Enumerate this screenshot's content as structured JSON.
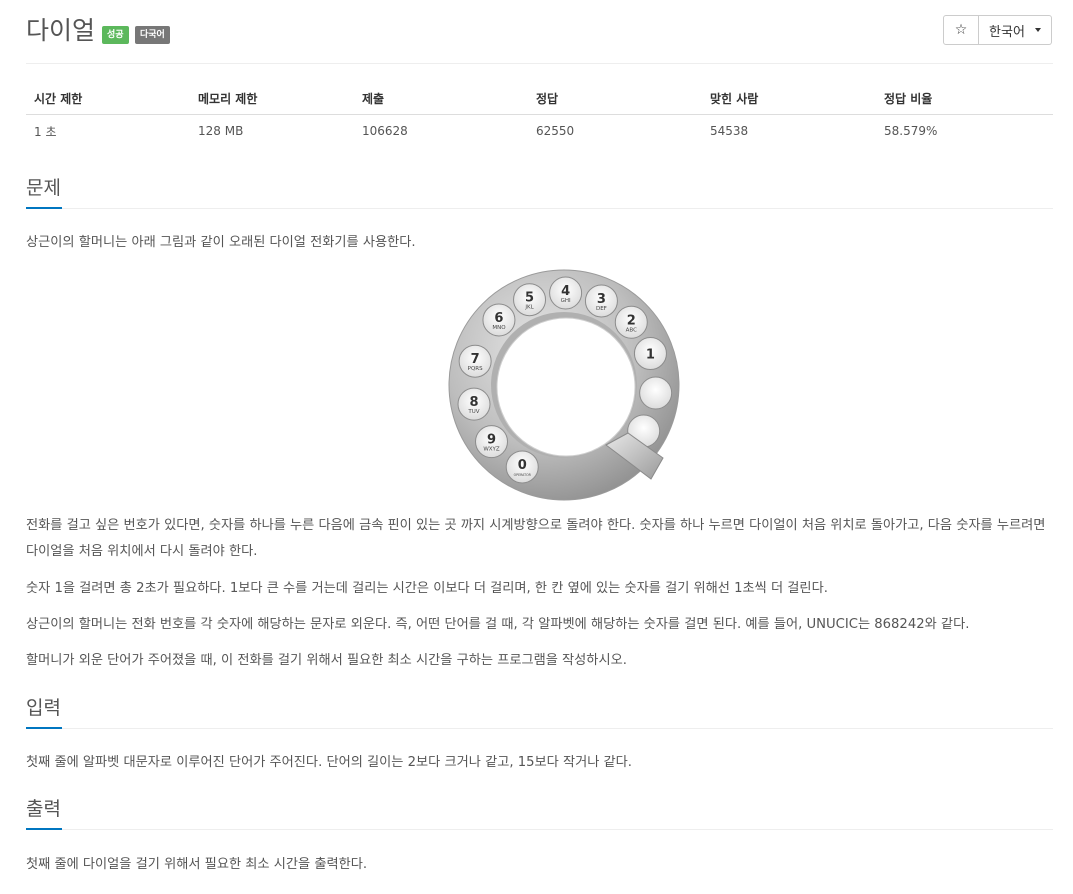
{
  "header": {
    "title": "다이얼",
    "badge_success": "성공",
    "badge_multilang": "다국어",
    "star_icon": "☆",
    "language": "한국어"
  },
  "stats": {
    "headers": [
      "시간 제한",
      "메모리 제한",
      "제출",
      "정답",
      "맞힌 사람",
      "정답 비율"
    ],
    "values": [
      "1 초",
      "128 MB",
      "106628",
      "62550",
      "54538",
      "58.579%"
    ]
  },
  "problem": {
    "heading": "문제",
    "intro": "상근이의 할머니는 아래 그림과 같이 오래된 다이얼 전화기를 사용한다.",
    "dial_labels": [
      {
        "digit": "1",
        "letters": ""
      },
      {
        "digit": "2",
        "letters": "ABC"
      },
      {
        "digit": "3",
        "letters": "DEF"
      },
      {
        "digit": "4",
        "letters": "GHI"
      },
      {
        "digit": "5",
        "letters": "JKL"
      },
      {
        "digit": "6",
        "letters": "MNO"
      },
      {
        "digit": "7",
        "letters": "PQRS"
      },
      {
        "digit": "8",
        "letters": "TUV"
      },
      {
        "digit": "9",
        "letters": "WXYZ"
      },
      {
        "digit": "0",
        "letters": "OPERATOR"
      }
    ],
    "p1": "전화를 걸고 싶은 번호가 있다면, 숫자를 하나를 누른 다음에 금속 핀이 있는 곳 까지 시계방향으로 돌려야 한다. 숫자를 하나 누르면 다이얼이 처음 위치로 돌아가고, 다음 숫자를 누르려면 다이얼을 처음 위치에서 다시 돌려야 한다.",
    "p2": "숫자 1을 걸려면 총 2초가 필요하다. 1보다 큰 수를 거는데 걸리는 시간은 이보다 더 걸리며, 한 칸 옆에 있는 숫자를 걸기 위해선 1초씩 더 걸린다.",
    "p3": "상근이의 할머니는 전화 번호를 각 숫자에 해당하는 문자로 외운다. 즉, 어떤 단어를 걸 때, 각 알파벳에 해당하는 숫자를 걸면 된다. 예를 들어, UNUCIC는 868242와 같다.",
    "p4": "할머니가 외운 단어가 주어졌을 때, 이 전화를 걸기 위해서 필요한 최소 시간을 구하는 프로그램을 작성하시오."
  },
  "input": {
    "heading": "입력",
    "text": "첫째 줄에 알파벳 대문자로 이루어진 단어가 주어진다. 단어의 길이는 2보다 크거나 같고, 15보다 작거나 같다."
  },
  "output": {
    "heading": "출력",
    "text": "첫째 줄에 다이얼을 걸기 위해서 필요한 최소 시간을 출력한다."
  }
}
